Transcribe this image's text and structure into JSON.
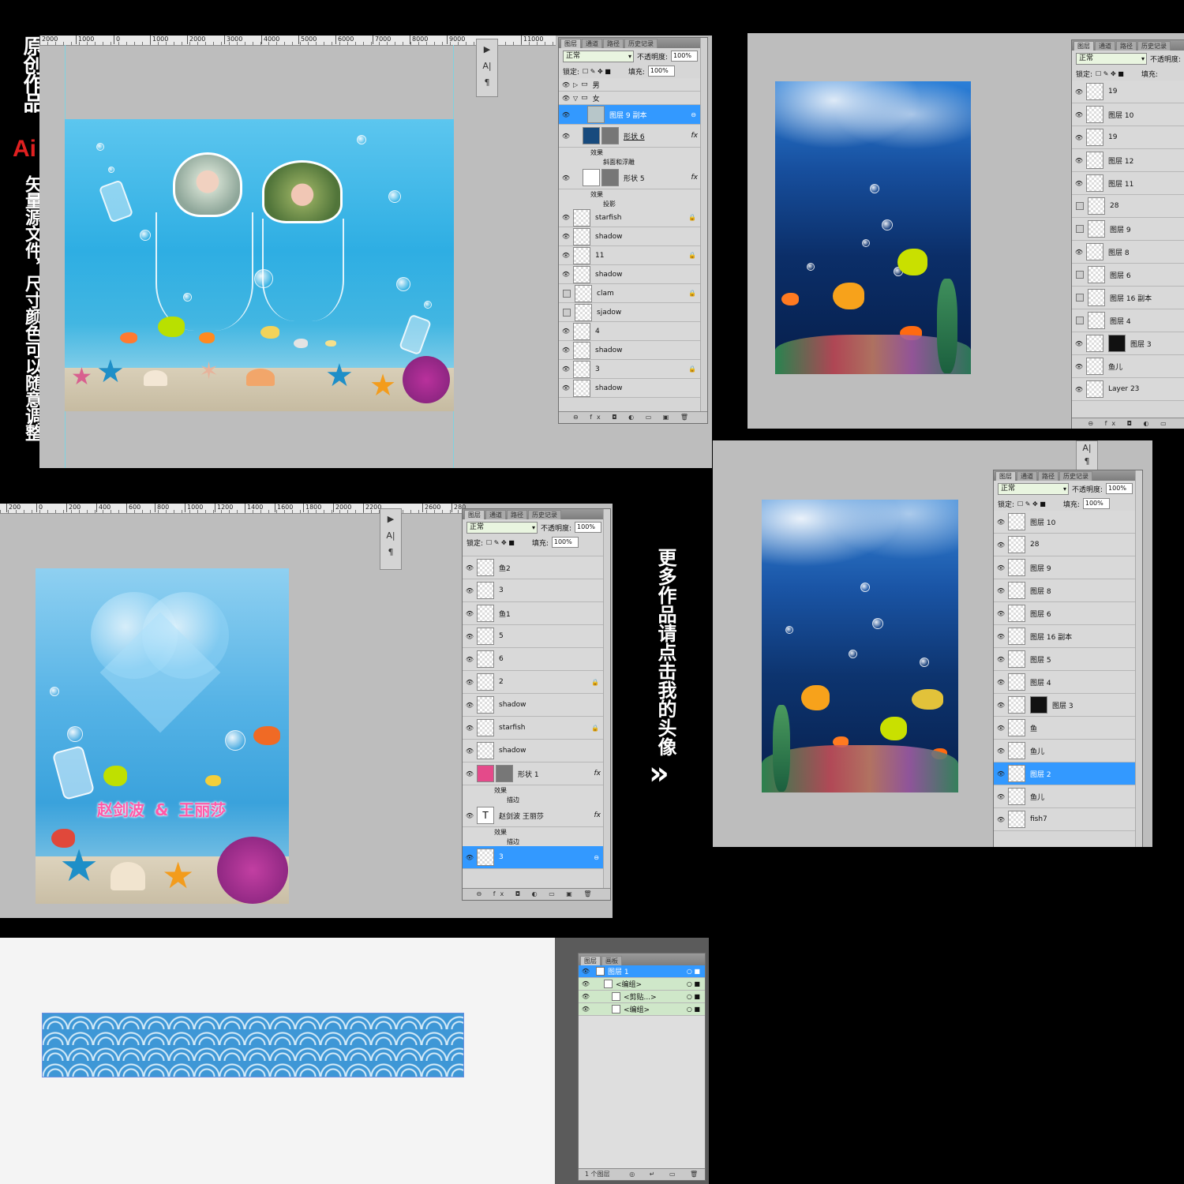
{
  "left_banner": {
    "line1": "原创作品",
    "ai": "Ai",
    "line2": "矢量源文件，尺寸颜色可以随意调整"
  },
  "more_works_text": "更多作品请点击我的头像",
  "more_works_arrow": "»",
  "shared_tabs": [
    "图层",
    "通道",
    "路径",
    "历史记录"
  ],
  "shared": {
    "blend_mode": "正常",
    "opacity_label": "不透明度:",
    "opacity_value": "100%",
    "lock_label": "锁定:",
    "fill_label": "填充:",
    "fill_value": "100%",
    "effects_label": "效果"
  },
  "win1": {
    "ruler": [
      "2000",
      "1000",
      "0",
      "1000",
      "2000",
      "3000",
      "4000",
      "5000",
      "6000",
      "7000",
      "8000",
      "9000",
      "11000"
    ],
    "group_boy": "男",
    "group_girl": "女",
    "layers_top": [
      {
        "name": "图层 9 副本",
        "selected": true
      },
      {
        "name": "形状 6",
        "fx": true
      },
      {
        "name": "斜面和浮雕",
        "sub": true
      },
      {
        "name": "形状 5",
        "fx": true
      },
      {
        "name": "投影",
        "sub": true
      }
    ],
    "layers": [
      {
        "name": "starfish",
        "lock": true,
        "visible": true
      },
      {
        "name": "shadow",
        "lock": false,
        "visible": true
      },
      {
        "name": "11",
        "lock": true,
        "visible": true
      },
      {
        "name": "shadow",
        "lock": false,
        "visible": true
      },
      {
        "name": "clam",
        "lock": true,
        "visible": false
      },
      {
        "name": "sjadow",
        "lock": false,
        "visible": false
      },
      {
        "name": "4",
        "lock": false,
        "visible": true
      },
      {
        "name": "shadow",
        "lock": false,
        "visible": true
      },
      {
        "name": "3",
        "lock": true,
        "visible": true
      },
      {
        "name": "shadow",
        "lock": false,
        "visible": true
      }
    ]
  },
  "win2": {
    "layers": [
      {
        "name": "19",
        "visible": true
      },
      {
        "name": "图层 10",
        "visible": true
      },
      {
        "name": "19",
        "visible": true
      },
      {
        "name": "图层 12",
        "visible": true
      },
      {
        "name": "图层 11",
        "visible": true
      },
      {
        "name": "28",
        "visible": false
      },
      {
        "name": "图层 9",
        "visible": false
      },
      {
        "name": "图层 8",
        "visible": true
      },
      {
        "name": "图层 6",
        "visible": false
      },
      {
        "name": "图层 16 副本",
        "visible": false
      },
      {
        "name": "图层 4",
        "visible": false
      },
      {
        "name": "图层 3",
        "visible": true,
        "mask": true
      },
      {
        "name": "鱼儿",
        "visible": true
      },
      {
        "name": "Layer 23",
        "visible": true
      }
    ]
  },
  "win3": {
    "ruler": [
      "200",
      "0",
      "200",
      "400",
      "600",
      "800",
      "1000",
      "1200",
      "1400",
      "1600",
      "1800",
      "2000",
      "2200",
      "2600",
      "280"
    ],
    "names_text": "赵剑波 & 王丽莎",
    "names_a": "赵剑波",
    "names_amp": "&",
    "names_b": "王丽莎",
    "layers": [
      {
        "name": "鱼2",
        "lock": false
      },
      {
        "name": "3",
        "lock": false
      },
      {
        "name": "鱼1",
        "lock": false
      },
      {
        "name": "5",
        "lock": false
      },
      {
        "name": "6",
        "lock": false
      },
      {
        "name": "2",
        "lock": true
      },
      {
        "name": "shadow",
        "lock": false
      },
      {
        "name": "starfish",
        "lock": true
      },
      {
        "name": "shadow",
        "lock": false
      }
    ],
    "shape_layer": "形状 1",
    "stroke_label": "描边",
    "text_layer": "赵剑波   王丽莎",
    "selected_layer": "3"
  },
  "win4": {
    "layers": [
      {
        "name": "图层 10"
      },
      {
        "name": "28"
      },
      {
        "name": "图层 9"
      },
      {
        "name": "图层 8"
      },
      {
        "name": "图层 6"
      },
      {
        "name": "图层 16 副本"
      },
      {
        "name": "图层 5"
      },
      {
        "name": "图层 4"
      },
      {
        "name": "图层 3",
        "mask": true
      },
      {
        "name": "鱼"
      },
      {
        "name": "鱼儿"
      },
      {
        "name": "图层 2",
        "selected": true
      },
      {
        "name": "鱼儿"
      },
      {
        "name": "fish7"
      }
    ]
  },
  "win5": {
    "tabs": [
      "图层",
      "画板"
    ],
    "layers": [
      {
        "name": "图层 1",
        "selected": true
      },
      {
        "name": "<编组>"
      },
      {
        "name": "<剪贴...>"
      },
      {
        "name": "<编组>"
      }
    ],
    "footer": "1 个图层"
  },
  "colors": {
    "select_blue": "#3399ff",
    "canvas_gray": "#bdbdbd",
    "banner_red": "#e02020",
    "name_pink": "#ff5aa8"
  }
}
